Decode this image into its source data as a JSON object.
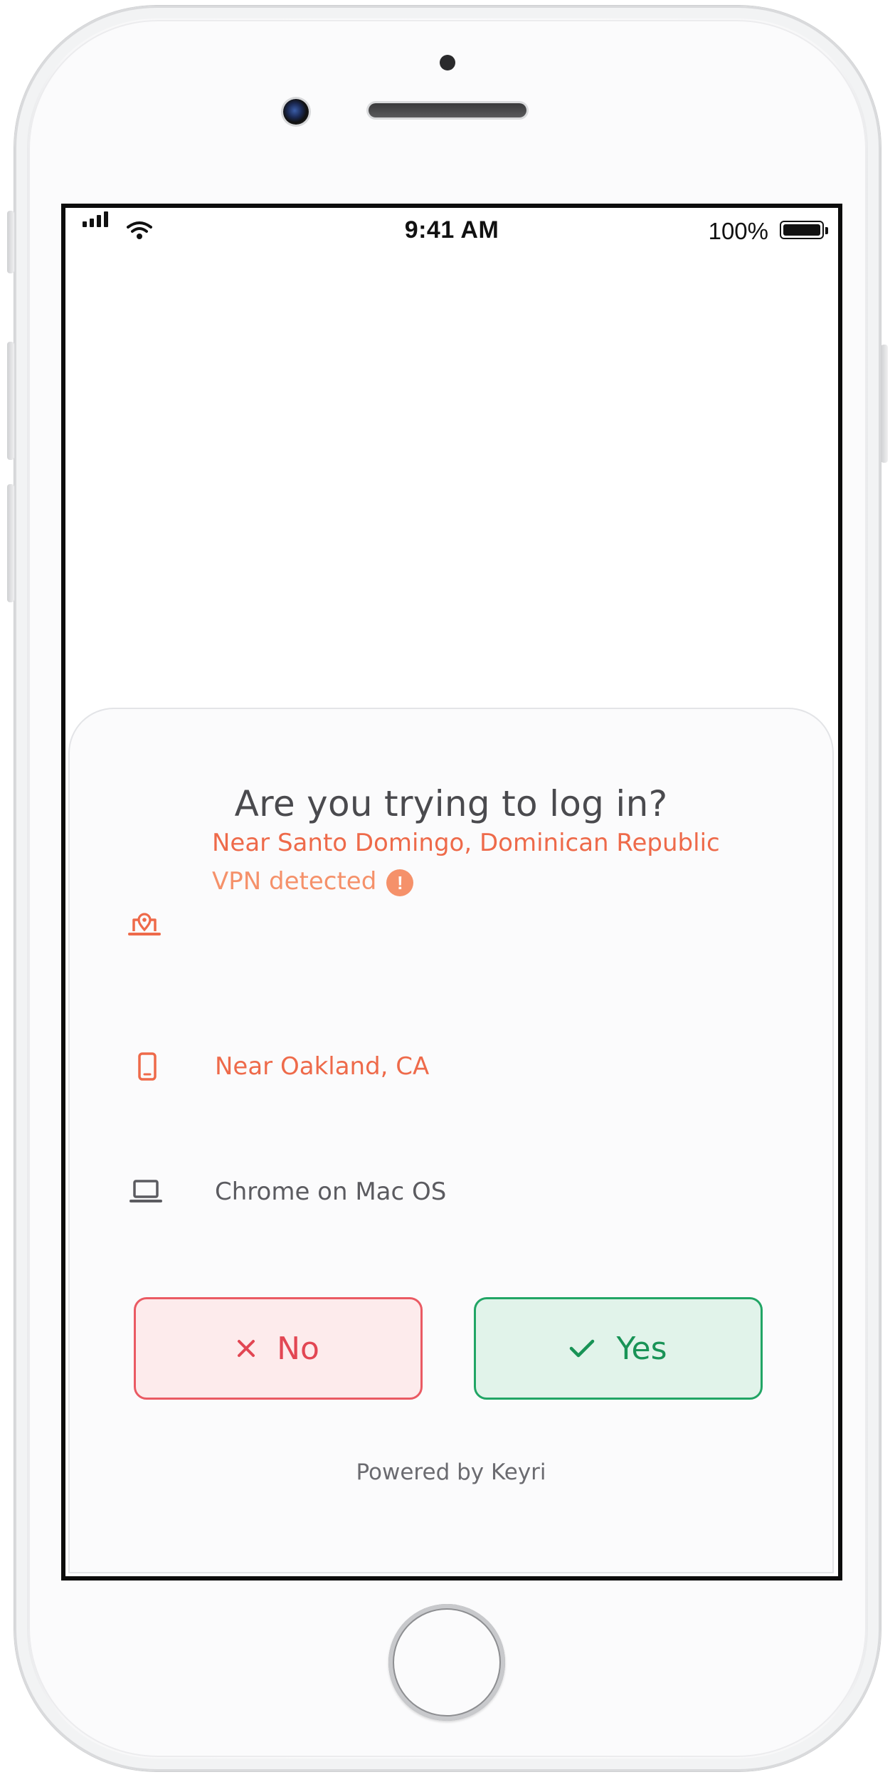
{
  "status_bar": {
    "time": "9:41 AM",
    "battery_percent": "100%",
    "battery_level": 1.0
  },
  "prompt": {
    "title": "Are you trying to log in?",
    "items": [
      {
        "icon": "laptop-location-icon",
        "primary": "Near Santo Domingo, Dominican Republic",
        "secondary": "VPN detected",
        "warning_glyph": "!"
      },
      {
        "icon": "phone-icon",
        "primary": "Near Oakland, CA"
      },
      {
        "icon": "laptop-icon",
        "primary": "Chrome on Mac OS"
      }
    ],
    "buttons": {
      "no_label": "No",
      "no_icon": "close-icon",
      "yes_label": "Yes",
      "yes_icon": "checkmark-icon"
    },
    "footer": "Powered by Keyri"
  },
  "colors": {
    "warning_orange": "#ee6a4a",
    "vpn_orange": "#f5916a",
    "no_red": "#e24653",
    "no_bg": "#fdebec",
    "yes_green": "#189356",
    "yes_bg": "#e1f3ea"
  }
}
